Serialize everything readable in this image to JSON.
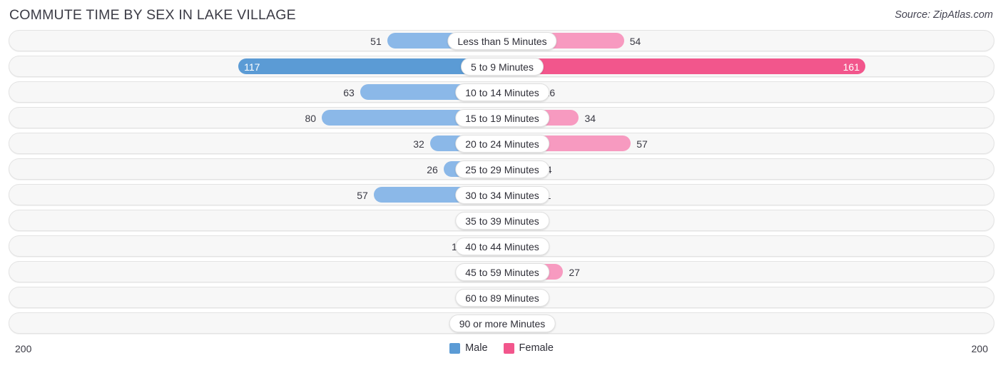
{
  "header": {
    "title": "COMMUTE TIME BY SEX IN LAKE VILLAGE",
    "source": "Source: ZipAtlas.com"
  },
  "axis": {
    "left_label": "200",
    "right_label": "200",
    "max": 200
  },
  "legend": {
    "items": [
      {
        "label": "Male",
        "color": "#5b9bd5"
      },
      {
        "label": "Female",
        "color": "#f2568c"
      }
    ]
  },
  "colors": {
    "male_light": "#8bb8e8",
    "male_strong": "#5b9bd5",
    "female_light": "#f79ac0",
    "female_strong": "#f2568c",
    "track": "#f7f7f7",
    "track_border": "#e3e3e3"
  },
  "chart_data": {
    "type": "bar",
    "subtype": "diverging-bidirectional",
    "title": "COMMUTE TIME BY SEX IN LAKE VILLAGE",
    "xlabel": "",
    "ylabel": "",
    "xlim": [
      200,
      200
    ],
    "grid": false,
    "legend_position": "bottom-center",
    "categories": [
      "Less than 5 Minutes",
      "5 to 9 Minutes",
      "10 to 14 Minutes",
      "15 to 19 Minutes",
      "20 to 24 Minutes",
      "25 to 29 Minutes",
      "30 to 34 Minutes",
      "35 to 39 Minutes",
      "40 to 44 Minutes",
      "45 to 59 Minutes",
      "60 to 89 Minutes",
      "90 or more Minutes"
    ],
    "series": [
      {
        "name": "Male",
        "direction": "left",
        "values": [
          51,
          117,
          63,
          80,
          32,
          26,
          57,
          0,
          15,
          0,
          1,
          0
        ]
      },
      {
        "name": "Female",
        "direction": "right",
        "values": [
          54,
          161,
          16,
          34,
          57,
          14,
          11,
          3,
          0,
          27,
          0,
          0
        ]
      }
    ]
  }
}
